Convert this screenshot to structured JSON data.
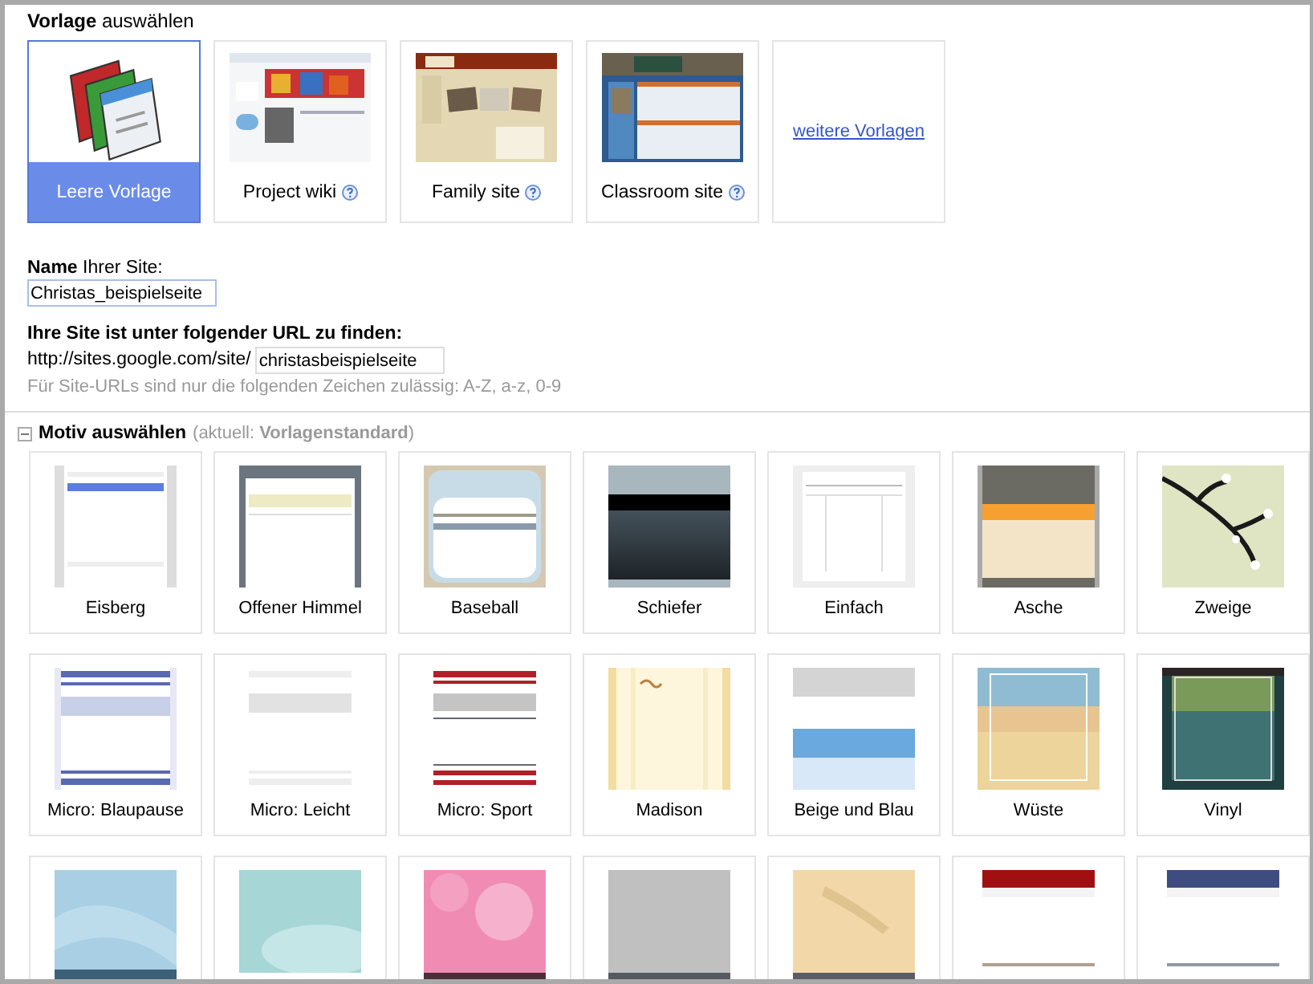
{
  "templates_section": {
    "heading": "**Vorlage** auswählen"
  },
  "templates": [
    {
      "kind": "blank",
      "label": "Leere Vorlage",
      "selected": true,
      "help": false
    },
    {
      "kind": "picture",
      "label": "Project wiki",
      "selected": false,
      "help": true
    },
    {
      "kind": "picture",
      "label": "Family site",
      "selected": false,
      "help": true
    },
    {
      "kind": "picture",
      "label": "Classroom site",
      "selected": false,
      "help": true
    },
    {
      "kind": "link",
      "label": "weitere Vorlagen",
      "selected": false
    }
  ],
  "site_name": {
    "label": "**Name** Ihrer Site:",
    "value": "Christas_beispielseite"
  },
  "site_url": {
    "label": "Ihre Site ist unter folgender URL zu finden:",
    "prefix": "http://sites.google.com/site/",
    "value": "christasbeispielseite",
    "hint": "Für Site-URLs sind nur die folgenden Zeichen zulässig: A-Z, a-z, 0-9"
  },
  "themes_section": {
    "expanded": true,
    "title": "Motiv auswählen",
    "current": "(aktuell: **Vorlagenstandard**)"
  },
  "themes": [
    {
      "kind": "full",
      "name": "Eisberg"
    },
    {
      "kind": "full",
      "name": "Offener Himmel"
    },
    {
      "kind": "full",
      "name": "Baseball"
    },
    {
      "kind": "full",
      "name": "Schiefer"
    },
    {
      "kind": "full",
      "name": "Einfach"
    },
    {
      "kind": "full",
      "name": "Asche"
    },
    {
      "kind": "full",
      "name": "Zweige"
    },
    {
      "kind": "full",
      "name": "Micro: Blaupause"
    },
    {
      "kind": "full",
      "name": "Micro: Leicht"
    },
    {
      "kind": "full",
      "name": "Micro: Sport"
    },
    {
      "kind": "full",
      "name": "Madison"
    },
    {
      "kind": "full",
      "name": "Beige und Blau"
    },
    {
      "kind": "full",
      "name": "Wüste"
    },
    {
      "kind": "full",
      "name": "Vinyl"
    },
    {
      "kind": "cut"
    },
    {
      "kind": "cut"
    },
    {
      "kind": "cut"
    },
    {
      "kind": "cut"
    },
    {
      "kind": "cut"
    },
    {
      "kind": "cut"
    },
    {
      "kind": "cut"
    }
  ]
}
